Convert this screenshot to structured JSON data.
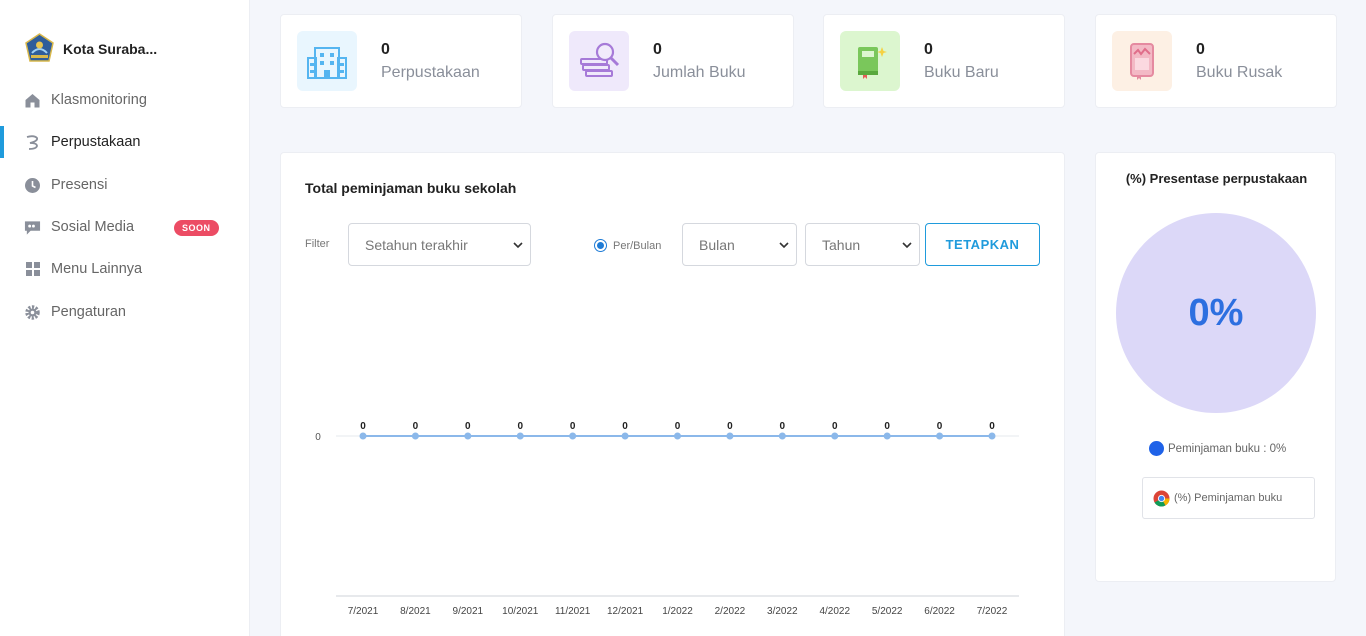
{
  "sidebar": {
    "brand": "Kota Suraba...",
    "items": [
      {
        "label": "Klasmonitoring"
      },
      {
        "label": "Perpustakaan"
      },
      {
        "label": "Presensi"
      },
      {
        "label": "Sosial Media",
        "badge": "SOON"
      },
      {
        "label": "Menu Lainnya"
      },
      {
        "label": "Pengaturan"
      }
    ]
  },
  "stats": [
    {
      "value": "0",
      "label": "Perpustakaan",
      "color": "#e9f6fe"
    },
    {
      "value": "0",
      "label": "Jumlah Buku",
      "color": "#efe9fb"
    },
    {
      "value": "0",
      "label": "Buku Baru",
      "color": "#dcf6cf"
    },
    {
      "value": "0",
      "label": "Buku Rusak",
      "color": "#fdf0e4"
    }
  ],
  "chart_section": {
    "title": "Total peminjaman buku sekolah",
    "filter_label": "Filter",
    "range_select": "Setahun terakhir",
    "radio_label": "Per/Bulan",
    "month_select": "Bulan",
    "year_select": "Tahun",
    "apply_button": "TETAPKAN"
  },
  "chart_data": {
    "type": "line",
    "categories": [
      "7/2021",
      "8/2021",
      "9/2021",
      "10/2021",
      "11/2021",
      "12/2021",
      "1/2022",
      "2/2022",
      "3/2022",
      "4/2022",
      "5/2022",
      "6/2022",
      "7/2022"
    ],
    "series": [
      {
        "values": [
          0,
          0,
          0,
          0,
          0,
          0,
          0,
          0,
          0,
          0,
          0,
          0,
          0
        ]
      }
    ],
    "yticks": [
      "0"
    ],
    "data_labels": true,
    "color": "#8bb8ea"
  },
  "pie_section": {
    "title": "(%) Presentase perpustakaan",
    "center_value": "0%",
    "legend": "Peminjaman buku : 0%",
    "button": "(%) Peminjaman buku",
    "fill_color": "#dcd8f8",
    "legend_color": "#1f62e8"
  }
}
